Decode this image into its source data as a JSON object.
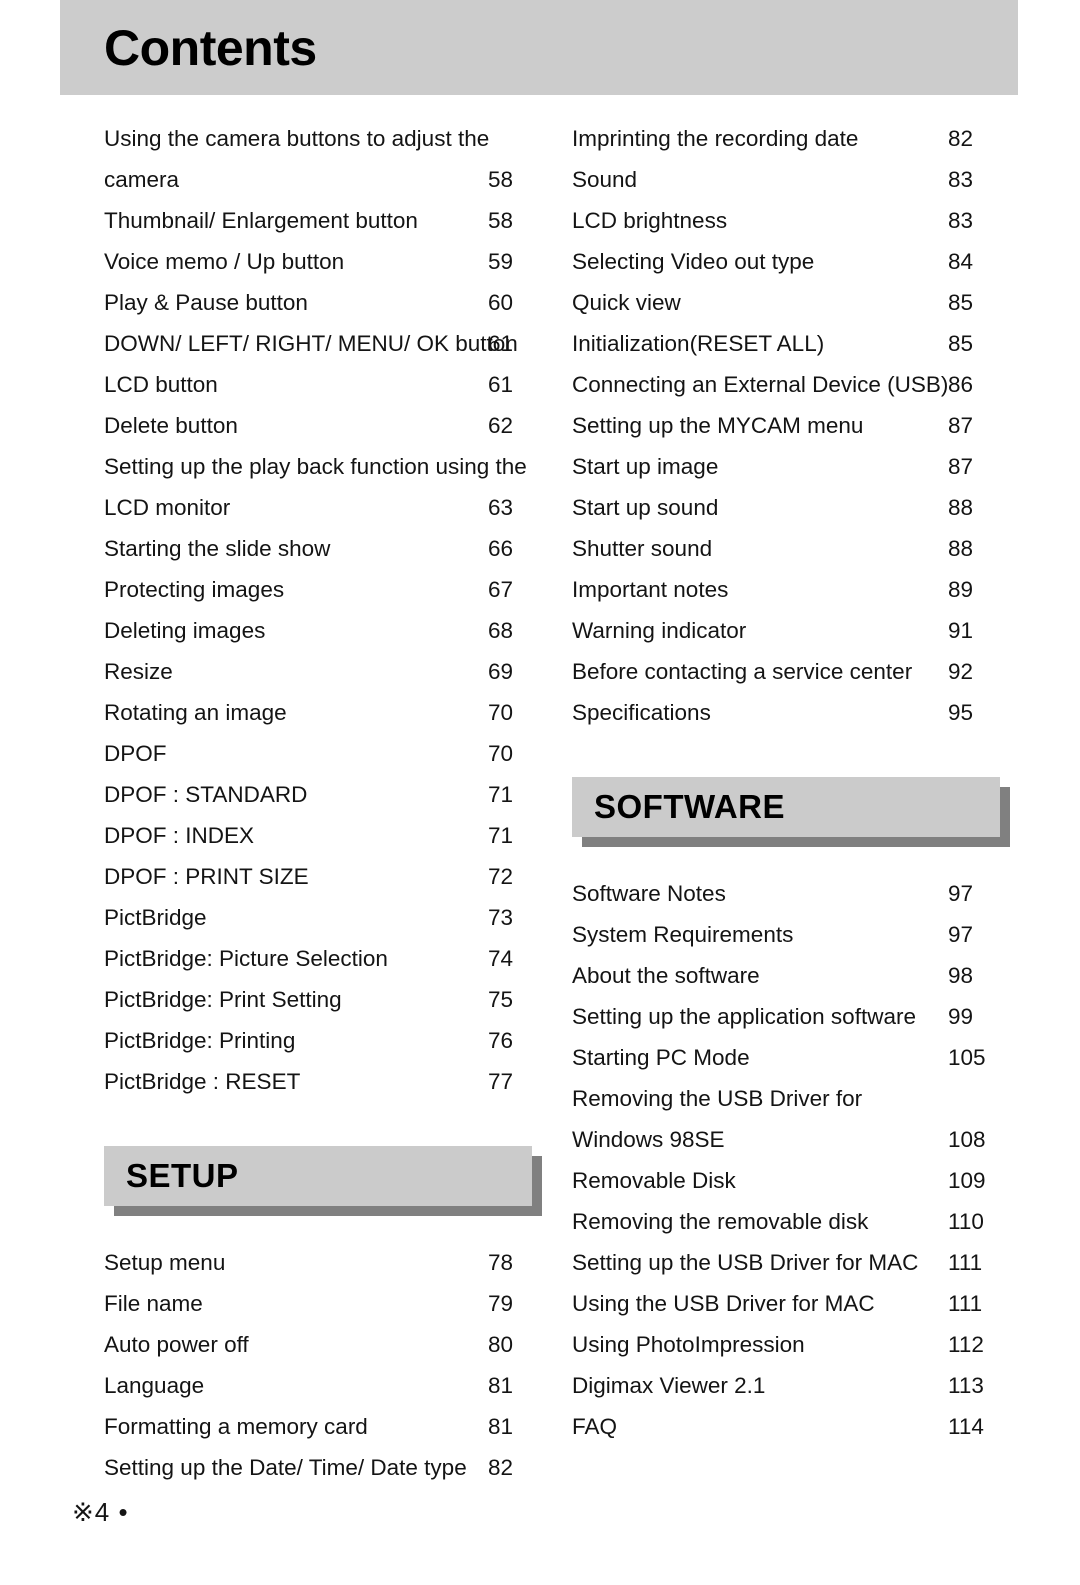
{
  "header": {
    "title": "Contents"
  },
  "footer": {
    "text": "※4 •"
  },
  "colors": {
    "header_band": "#cccccc",
    "banner_fill": "#cbcbcb",
    "banner_shadow": "#808080",
    "text": "#141414"
  },
  "left_column": {
    "entries": [
      {
        "label": "Using the camera buttons to adjust the",
        "page": ""
      },
      {
        "label": "camera",
        "page": "58"
      },
      {
        "label": "Thumbnail/ Enlargement button",
        "page": "58"
      },
      {
        "label": "Voice memo / Up button",
        "page": "59"
      },
      {
        "label": "Play & Pause button",
        "page": "60"
      },
      {
        "label": "DOWN/ LEFT/ RIGHT/ MENU/ OK button",
        "page": "61"
      },
      {
        "label": "LCD button",
        "page": "61"
      },
      {
        "label": "Delete button",
        "page": "62"
      },
      {
        "label": "Setting up the play back function using the",
        "page": ""
      },
      {
        "label": "LCD monitor",
        "page": "63"
      },
      {
        "label": "Starting the slide show",
        "page": "66"
      },
      {
        "label": "Protecting images",
        "page": "67"
      },
      {
        "label": "Deleting images",
        "page": "68"
      },
      {
        "label": "Resize",
        "page": "69"
      },
      {
        "label": "Rotating an image",
        "page": "70"
      },
      {
        "label": "DPOF",
        "page": "70"
      },
      {
        "label": "DPOF : STANDARD",
        "page": "71"
      },
      {
        "label": "DPOF : INDEX",
        "page": "71"
      },
      {
        "label": "DPOF : PRINT SIZE",
        "page": "72"
      },
      {
        "label": "PictBridge",
        "page": "73"
      },
      {
        "label": "PictBridge: Picture Selection",
        "page": "74"
      },
      {
        "label": "PictBridge: Print Setting",
        "page": "75"
      },
      {
        "label": "PictBridge: Printing",
        "page": "76"
      },
      {
        "label": "PictBridge : RESET",
        "page": "77"
      }
    ],
    "section": {
      "title": "SETUP",
      "entries": [
        {
          "label": "Setup menu",
          "page": "78"
        },
        {
          "label": "File name",
          "page": "79"
        },
        {
          "label": "Auto power off",
          "page": "80"
        },
        {
          "label": "Language",
          "page": "81"
        },
        {
          "label": "Formatting a memory card",
          "page": "81"
        },
        {
          "label": "Setting up the Date/ Time/ Date type",
          "page": "82"
        }
      ]
    }
  },
  "right_column": {
    "entries": [
      {
        "label": "Imprinting the recording date",
        "page": "82"
      },
      {
        "label": "Sound",
        "page": "83"
      },
      {
        "label": "LCD brightness",
        "page": "83"
      },
      {
        "label": "Selecting Video out type",
        "page": "84"
      },
      {
        "label": "Quick view",
        "page": "85"
      },
      {
        "label": "Initialization(RESET ALL)",
        "page": "85"
      },
      {
        "label": "Connecting an External Device (USB)",
        "page": "86"
      },
      {
        "label": "Setting up the MYCAM menu",
        "page": "87"
      },
      {
        "label": "Start up image",
        "page": "87"
      },
      {
        "label": "Start up sound",
        "page": "88"
      },
      {
        "label": "Shutter sound",
        "page": "88"
      },
      {
        "label": "Important notes",
        "page": "89"
      },
      {
        "label": "Warning indicator",
        "page": "91"
      },
      {
        "label": "Before contacting a service center",
        "page": "92"
      },
      {
        "label": "Specifications",
        "page": "95"
      }
    ],
    "section": {
      "title": "SOFTWARE",
      "entries": [
        {
          "label": "Software Notes",
          "page": "97"
        },
        {
          "label": "System Requirements",
          "page": "97"
        },
        {
          "label": "About the software",
          "page": "98"
        },
        {
          "label": "Setting up the application software",
          "page": "99"
        },
        {
          "label": "Starting PC Mode",
          "page": "105"
        },
        {
          "label": "Removing the USB Driver for",
          "page": ""
        },
        {
          "label": "Windows 98SE",
          "page": "108"
        },
        {
          "label": "Removable Disk",
          "page": "109"
        },
        {
          "label": "Removing the removable disk",
          "page": "110"
        },
        {
          "label": "Setting up the USB Driver for MAC",
          "page": "111"
        },
        {
          "label": "Using the USB Driver for MAC",
          "page": "111"
        },
        {
          "label": "Using PhotoImpression",
          "page": "112"
        },
        {
          "label": "Digimax Viewer 2.1",
          "page": "113"
        },
        {
          "label": "FAQ",
          "page": "114"
        }
      ]
    }
  }
}
